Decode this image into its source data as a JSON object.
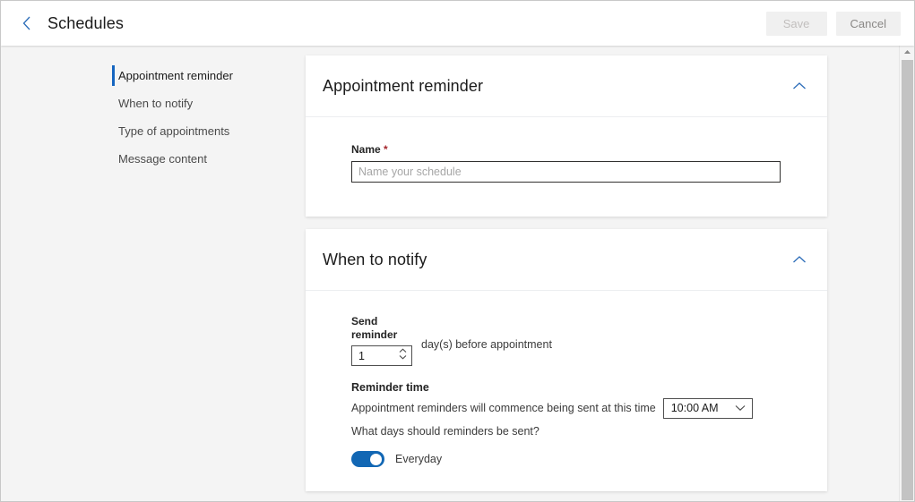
{
  "header": {
    "back_icon": "chevron-left-icon",
    "title": "Schedules",
    "save_label": "Save",
    "cancel_label": "Cancel"
  },
  "sidebar": {
    "items": [
      {
        "label": "Appointment reminder",
        "active": true
      },
      {
        "label": "When to notify",
        "active": false
      },
      {
        "label": "Type of appointments",
        "active": false
      },
      {
        "label": "Message content",
        "active": false
      }
    ]
  },
  "cards": {
    "appointment_reminder": {
      "title": "Appointment reminder",
      "collapse_icon": "chevron-up-icon",
      "name_label": "Name",
      "name_required_marker": "*",
      "name_value": "",
      "name_placeholder": "Name your schedule"
    },
    "when_to_notify": {
      "title": "When to notify",
      "collapse_icon": "chevron-up-icon",
      "send_reminder_label": "Send reminder",
      "send_reminder_value": "1",
      "days_before_text": "day(s) before appointment",
      "reminder_time_label": "Reminder time",
      "commence_text": "Appointment reminders will commence being sent at this time",
      "time_value": "10:00 AM",
      "time_dropdown_icon": "chevron-down-icon",
      "days_question": "What days should reminders be sent?",
      "everyday_label": "Everyday",
      "everyday_on": true
    }
  },
  "scrollbar": {
    "up_arrow_icon": "caret-up-icon"
  },
  "colors": {
    "accent_blue": "#1565c0",
    "toggle_blue": "#1267b4",
    "required_red": "#a4262c",
    "page_bg": "#f4f4f4",
    "card_bg": "#ffffff"
  }
}
